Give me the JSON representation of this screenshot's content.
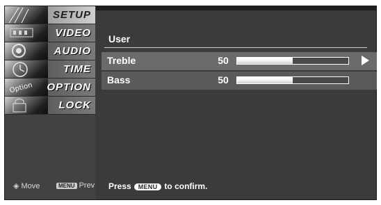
{
  "sidebar": {
    "items": [
      {
        "label": "SETUP",
        "icon": "setup-icon",
        "active": true
      },
      {
        "label": "VIDEO",
        "icon": "video-icon",
        "active": false
      },
      {
        "label": "AUDIO",
        "icon": "audio-icon",
        "active": false
      },
      {
        "label": "TIME",
        "icon": "clock-icon",
        "active": false
      },
      {
        "label": "OPTION",
        "icon": "option-icon",
        "thumb_text": "Option",
        "active": false
      },
      {
        "label": "LOCK",
        "icon": "lock-icon",
        "active": false
      }
    ],
    "hints": {
      "move_label": "Move",
      "prev_badge": "MENU",
      "prev_label": "Prev"
    }
  },
  "main": {
    "header": "User",
    "rows": [
      {
        "label": "Treble",
        "value": "50",
        "level": 0.5,
        "has_arrow": true
      },
      {
        "label": "Bass",
        "value": "50",
        "level": 0.5,
        "has_arrow": false
      }
    ],
    "footer": {
      "press": "Press",
      "menu_badge": "MENU",
      "confirm": "to confirm."
    }
  },
  "colors": {
    "panel": "#3b3b3b",
    "sidebar_active": "#d0d0d0",
    "row_selected": "#6b6b6b"
  }
}
